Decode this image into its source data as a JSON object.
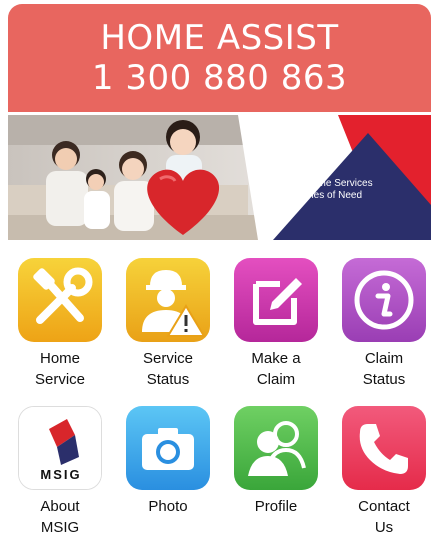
{
  "header": {
    "title": "HOME ASSIST",
    "phone": "1 300 880 863",
    "color": "#e8665f"
  },
  "banner": {
    "tagline_line1": "For Home Services",
    "tagline_line2": "in Times of Need",
    "accent_navy": "#2b2f6b",
    "accent_red": "#e3212d"
  },
  "tiles": [
    {
      "label1": "Home",
      "label2": "Service",
      "icon": "tools-icon"
    },
    {
      "label1": "Service",
      "label2": "Status",
      "icon": "worker-warning-icon"
    },
    {
      "label1": "Make a",
      "label2": "Claim",
      "icon": "edit-icon"
    },
    {
      "label1": "Claim",
      "label2": "Status",
      "icon": "info-icon"
    },
    {
      "label1": "About",
      "label2": "MSIG",
      "icon": "msig-logo-icon",
      "logo_text": "MSIG"
    },
    {
      "label1": "Photo",
      "label2": "",
      "icon": "camera-icon"
    },
    {
      "label1": "Profile",
      "label2": "",
      "icon": "contacts-icon"
    },
    {
      "label1": "Contact",
      "label2": "Us",
      "icon": "phone-icon"
    }
  ]
}
